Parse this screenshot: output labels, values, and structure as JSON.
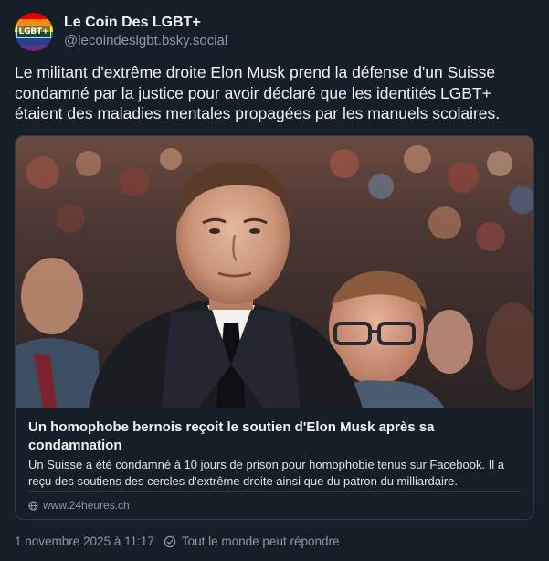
{
  "author": {
    "display_name": "Le Coin Des LGBT+",
    "handle": "@lecoindeslgbt.bsky.social",
    "avatar_text": "LGBT+",
    "avatar_stripes": [
      "#e40303",
      "#ff8c00",
      "#ffed00",
      "#008026",
      "#24408e",
      "#732982"
    ]
  },
  "post": {
    "text": "Le militant d'extrême droite Elon Musk prend la défense d'un Suisse condamné par la justice pour avoir déclaré que les identités LGBT+ étaient des maladies mentales propagées par les manuels scolaires."
  },
  "link_card": {
    "image_icon": "photo-of-elon-musk-in-crowd",
    "title": "Un homophobe bernois reçoit le soutien d'Elon Musk après sa condamnation",
    "description": "Un Suisse a été condamné à 10 jours de prison pour homophobie tenus sur Facebook. Il a reçu des soutiens des cercles d'extrême droite ainsi que du patron du milliardaire.",
    "domain": "www.24heures.ch",
    "domain_icon": "globe-icon"
  },
  "footer": {
    "timestamp": "1 novembre 2025 à 11:17",
    "reply_setting": "Tout le monde peut répondre",
    "reply_icon": "reply-settings-icon"
  },
  "colors": {
    "background": "#161e27",
    "text_primary": "#f1f3f5",
    "text_secondary": "#8c9aab",
    "border": "#2e3b4a"
  }
}
